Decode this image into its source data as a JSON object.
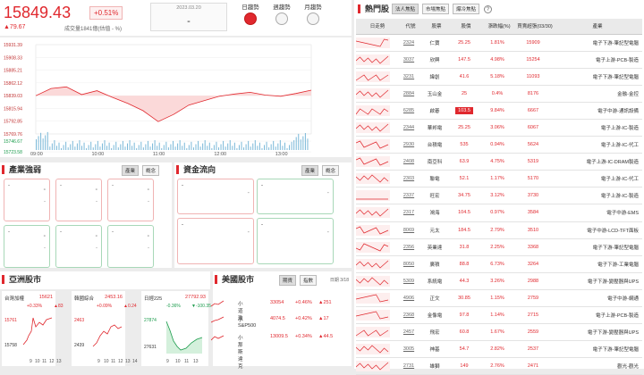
{
  "quote": {
    "price": "15849.43",
    "pct": "+0.51%",
    "change": "▲79.67",
    "volume": "成交量1841億(估值 - %)",
    "date": "2023.03.20",
    "date_value": "-"
  },
  "trend": {
    "labels": [
      "日趨勢",
      "週趨勢",
      "月趨勢"
    ]
  },
  "main_chart": {
    "y_ticks": [
      "15931.39",
      "15908.33",
      "15885.21",
      "15862.12",
      "15839.03",
      "15815.94",
      "15792.85",
      "15769.76",
      "15746.67",
      "15723.58"
    ],
    "x_ticks": [
      "09:00",
      "10:00",
      "11:00",
      "12:00",
      "13:00"
    ]
  },
  "chart_data": {
    "type": "line",
    "x": [
      "09:00",
      "09:15",
      "09:30",
      "09:45",
      "10:00",
      "10:15",
      "10:30",
      "10:45",
      "11:00",
      "11:15",
      "11:30",
      "11:45",
      "12:00",
      "12:15",
      "12:30",
      "12:45",
      "13:00",
      "13:15",
      "13:30"
    ],
    "y": [
      15839,
      15852,
      15855,
      15841,
      15848,
      15836,
      15825,
      15812,
      15792,
      15805,
      15822,
      15830,
      15838,
      15842,
      15845,
      15840,
      15838,
      15843,
      15849
    ],
    "ylim": [
      15769.76,
      15931.39
    ]
  },
  "industry": {
    "title": "產業強弱",
    "tabs": [
      "產業",
      "概念"
    ],
    "cells": [
      "-",
      "-",
      "-",
      "-",
      "-",
      "-"
    ]
  },
  "fundflow": {
    "title": "資金流向",
    "tabs": [
      "產業",
      "概念"
    ],
    "cells": [
      "-",
      "-",
      "-",
      "-"
    ]
  },
  "asia": {
    "title": "亞洲股市",
    "cards": [
      {
        "name": "台灣加權",
        "value": "15621",
        "pct": "+0.33%",
        "chg": "▲83",
        "lo": "15761",
        "lo2": "15758",
        "cls": "up"
      },
      {
        "name": "韓國綜合",
        "value": "2453.16",
        "pct": "+0.09%",
        "chg": "▲0.24",
        "lo": "2463",
        "lo2": "2439",
        "cls": "up"
      },
      {
        "name": "日經225",
        "value": "27792.93",
        "pct": "-0.36%",
        "chg": "▼-100.35",
        "lo": "27874",
        "lo2": "27631",
        "cls": "down"
      }
    ],
    "x_ticks": [
      "9",
      "10",
      "11",
      "12",
      "13",
      "14"
    ]
  },
  "us": {
    "title": "美國股市",
    "tabs": [
      "期貨",
      "指數"
    ],
    "date": "日期 3/18",
    "rows": [
      {
        "name": "小道瓊",
        "value": "33054",
        "pct": "+0.46%",
        "chg": "▲251"
      },
      {
        "name": "小S&P500",
        "value": "4074.5",
        "pct": "+0.42%",
        "chg": "▲17"
      },
      {
        "name": "小那斯達克",
        "value": "13009.5",
        "pct": "+0.34%",
        "chg": "▲44.5"
      }
    ]
  },
  "hot": {
    "title": "熱門股",
    "tabs": [
      "法人焦點",
      "市場焦點",
      "爆冷焦點"
    ],
    "headers": [
      "日走勢",
      "代號",
      "股票",
      "股價",
      "漲跌幅(%)",
      "買賣超張(03/30)",
      "產業"
    ],
    "rows": [
      {
        "code": "2324",
        "name": "仁寶",
        "price": "25.25",
        "pct": "1.81%",
        "vol": "15909",
        "ind": "電子下游-筆記型電腦"
      },
      {
        "code": "3037",
        "name": "欣興",
        "price": "147.5",
        "pct": "4.98%",
        "vol": "15254",
        "ind": "電子上游-PCB-製造"
      },
      {
        "code": "3231",
        "name": "緯創",
        "price": "41.6",
        "pct": "5.18%",
        "vol": "11093",
        "ind": "電子下游-筆記型電腦"
      },
      {
        "code": "2884",
        "name": "玉山金",
        "price": "25",
        "pct": "0.4%",
        "vol": "8176",
        "ind": "金融-金控"
      },
      {
        "code": "6285",
        "name": "啟碁",
        "price": "103.5",
        "pct": "9.84%",
        "vol": "6667",
        "ind": "電子中游-通訊設備",
        "hl": true
      },
      {
        "code": "2344",
        "name": "華邦電",
        "price": "25.25",
        "pct": "3.06%",
        "vol": "6067",
        "ind": "電子上游-IC-製造"
      },
      {
        "code": "2930",
        "name": "台積電",
        "price": "535",
        "pct": "0.94%",
        "vol": "5624",
        "ind": "電子上游-IC-代工"
      },
      {
        "code": "2408",
        "name": "南亞科",
        "price": "63.9",
        "pct": "4.75%",
        "vol": "5319",
        "ind": "電子上游-IC-DRAM製造"
      },
      {
        "code": "2303",
        "name": "聯電",
        "price": "52.1",
        "pct": "1.17%",
        "vol": "5170",
        "ind": "電子上游-IC-代工"
      },
      {
        "code": "2337",
        "name": "旺宏",
        "price": "34.75",
        "pct": "3.12%",
        "vol": "3730",
        "ind": "電子上游-IC-製造"
      },
      {
        "code": "2317",
        "name": "鴻海",
        "price": "104.5",
        "pct": "0.97%",
        "vol": "3584",
        "ind": "電子中游-EMS"
      },
      {
        "code": "8069",
        "name": "元太",
        "price": "184.5",
        "pct": "2.79%",
        "vol": "3510",
        "ind": "電子中游-LCD-TFT面板"
      },
      {
        "code": "2356",
        "name": "英業達",
        "price": "31.8",
        "pct": "2.25%",
        "vol": "3368",
        "ind": "電子下游-筆記型電腦"
      },
      {
        "code": "8050",
        "name": "廣積",
        "price": "88.8",
        "pct": "6.73%",
        "vol": "3264",
        "ind": "電子下游-工業電腦"
      },
      {
        "code": "5309",
        "name": "系統電",
        "price": "44.3",
        "pct": "3.26%",
        "vol": "2988",
        "ind": "電子下游-變壓器與UPS"
      },
      {
        "code": "4906",
        "name": "正文",
        "price": "30.85",
        "pct": "1.15%",
        "vol": "2759",
        "ind": "電子中游-網通"
      },
      {
        "code": "2368",
        "name": "金像電",
        "price": "97.8",
        "pct": "1.14%",
        "vol": "2715",
        "ind": "電子上游-PCB-製造"
      },
      {
        "code": "2457",
        "name": "飛宏",
        "price": "60.8",
        "pct": "1.67%",
        "vol": "2559",
        "ind": "電子下游-變壓器與UPS"
      },
      {
        "code": "3005",
        "name": "神基",
        "price": "54.7",
        "pct": "2.82%",
        "vol": "2537",
        "ind": "電子下游-筆記型電腦"
      },
      {
        "code": "2731",
        "name": "雄獅",
        "price": "149",
        "pct": "2.76%",
        "vol": "2471",
        "ind": "觀光-觀光"
      }
    ]
  }
}
